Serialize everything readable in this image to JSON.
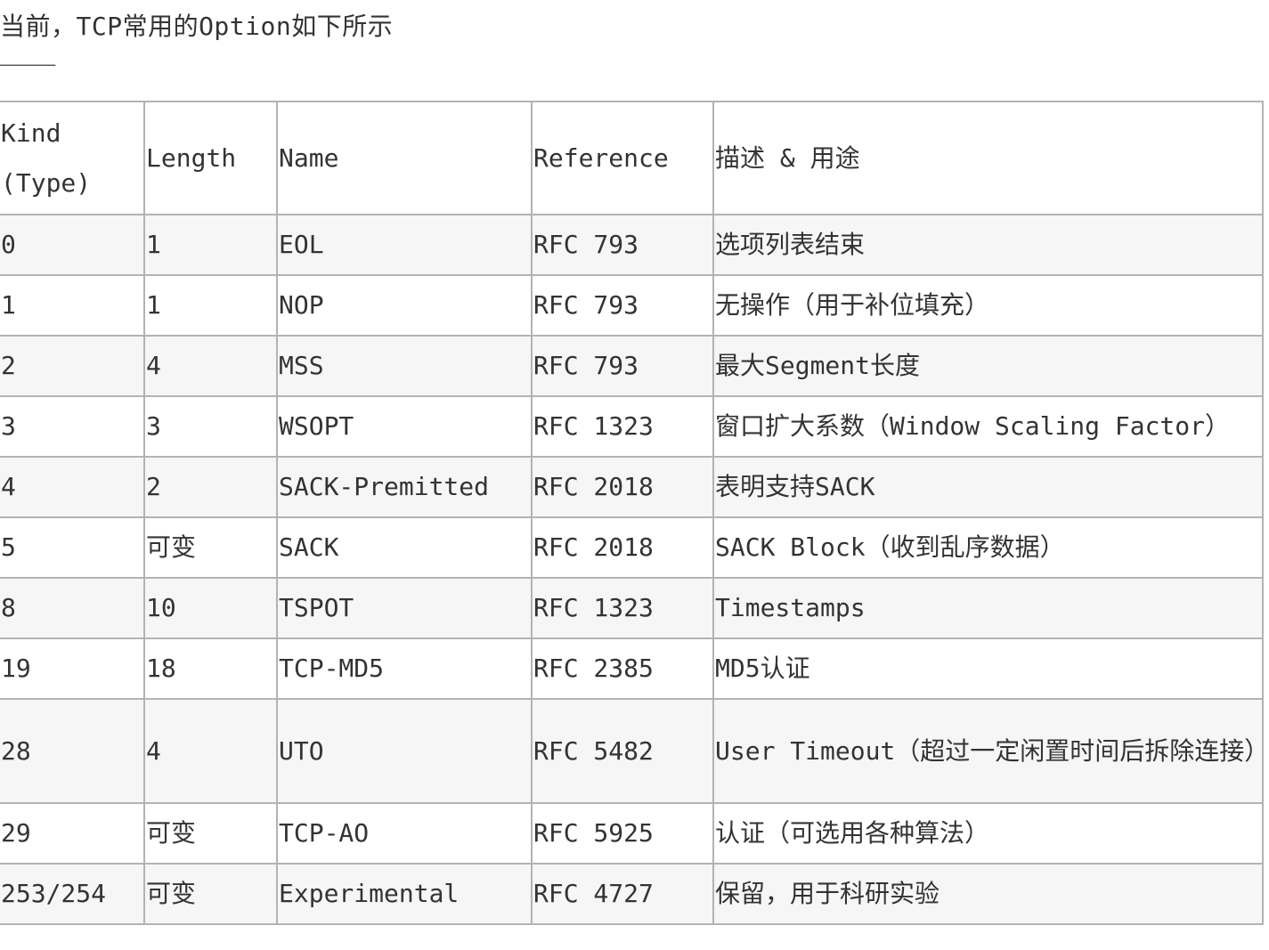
{
  "intro": "当前，TCP常用的Option如下所示",
  "divider": "——————",
  "table": {
    "headers": {
      "kind_line1": "Kind",
      "kind_line2": "(Type)",
      "length": "Length",
      "name": "Name",
      "reference": "Reference",
      "description": "描述 & 用途"
    },
    "rows": [
      {
        "kind": "0",
        "length": "1",
        "name": "EOL",
        "reference": "RFC 793",
        "description": "选项列表结束"
      },
      {
        "kind": "1",
        "length": "1",
        "name": "NOP",
        "reference": "RFC 793",
        "description": "无操作（用于补位填充）"
      },
      {
        "kind": "2",
        "length": "4",
        "name": "MSS",
        "reference": "RFC 793",
        "description": "最大Segment长度"
      },
      {
        "kind": "3",
        "length": "3",
        "name": "WSOPT",
        "reference": "RFC 1323",
        "description": "窗口扩大系数（Window Scaling Factor）"
      },
      {
        "kind": "4",
        "length": "2",
        "name": "SACK-Premitted",
        "reference": "RFC 2018",
        "description": "表明支持SACK"
      },
      {
        "kind": "5",
        "length": "可变",
        "name": "SACK",
        "reference": "RFC 2018",
        "description": "SACK Block（收到乱序数据）"
      },
      {
        "kind": "8",
        "length": "10",
        "name": "TSPOT",
        "reference": "RFC 1323",
        "description": "Timestamps"
      },
      {
        "kind": "19",
        "length": "18",
        "name": "TCP-MD5",
        "reference": "RFC 2385",
        "description": "MD5认证"
      },
      {
        "kind": "28",
        "length": "4",
        "name": "UTO",
        "reference": "RFC 5482",
        "description": "User Timeout（超过一定闲置时间后拆除连接）"
      },
      {
        "kind": "29",
        "length": "可变",
        "name": "TCP-AO",
        "reference": "RFC 5925",
        "description": "认证（可选用各种算法）"
      },
      {
        "kind": "253/254",
        "length": "可变",
        "name": "Experimental",
        "reference": "RFC 4727",
        "description": "保留，用于科研实验"
      }
    ]
  }
}
